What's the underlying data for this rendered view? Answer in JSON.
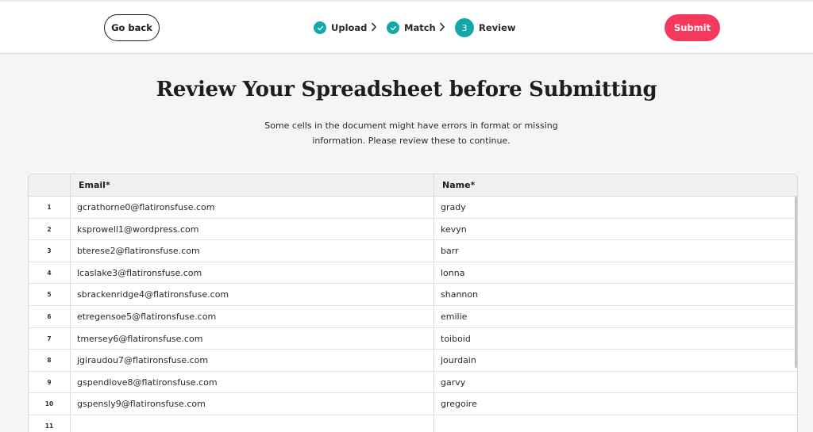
{
  "header": {
    "back_label": "Go back",
    "submit_label": "Submit",
    "steps": [
      {
        "label": "Upload",
        "state": "done",
        "icon": "check-icon"
      },
      {
        "label": "Match",
        "state": "done",
        "icon": "check-icon"
      },
      {
        "label": "Review",
        "state": "current",
        "number": "3"
      }
    ]
  },
  "colors": {
    "accent_teal": "#12a8a8",
    "submit_red": "#f5395c"
  },
  "page": {
    "title": "Review Your Spreadsheet before Submitting",
    "subtitle_line1": "Some cells in the document might have errors in format or missing",
    "subtitle_line2": "information. Please review these to continue."
  },
  "table": {
    "columns": [
      "Email*",
      "Name*"
    ],
    "rows": [
      {
        "index": "1",
        "email": "gcrathorne0@flatironsfuse.com",
        "name": "grady"
      },
      {
        "index": "2",
        "email": "ksprowell1@wordpress.com",
        "name": "kevyn"
      },
      {
        "index": "3",
        "email": "bterese2@flatironsfuse.com",
        "name": "barr"
      },
      {
        "index": "4",
        "email": "lcaslake3@flatironsfuse.com",
        "name": "lonna"
      },
      {
        "index": "5",
        "email": "sbrackenridge4@flatironsfuse.com",
        "name": "shannon"
      },
      {
        "index": "6",
        "email": "etregensoe5@flatironsfuse.com",
        "name": "emilie"
      },
      {
        "index": "7",
        "email": "tmersey6@flatironsfuse.com",
        "name": "toiboid"
      },
      {
        "index": "8",
        "email": "jgiraudou7@flatironsfuse.com",
        "name": "jourdain"
      },
      {
        "index": "9",
        "email": "gspendlove8@flatironsfuse.com",
        "name": "garvy"
      },
      {
        "index": "10",
        "email": "gspensly9@flatironsfuse.com",
        "name": "gregoire"
      },
      {
        "index": "11",
        "email": "",
        "name": ""
      }
    ]
  }
}
